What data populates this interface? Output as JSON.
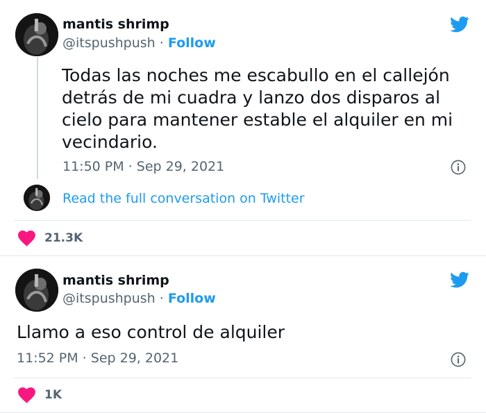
{
  "tweets": [
    {
      "author": "mantis shrimp",
      "handle": "@itspushpush",
      "separator": "·",
      "follow": "Follow",
      "text": "Todas las noches me escabullo en el callejón detrás de mi cuadra y lanzo dos disparos al cielo para mantener estable el alquiler en mi vecindario.",
      "time": "11:50 PM · Sep 29, 2021",
      "read_link": "Read the full conversation on Twitter",
      "likes": "21.3K"
    },
    {
      "author": "mantis shrimp",
      "handle": "@itspushpush",
      "separator": "·",
      "follow": "Follow",
      "text": "Llamo a eso control de alquiler",
      "time": "11:52 PM · Sep 29, 2021",
      "likes": "1K"
    }
  ],
  "colors": {
    "brand_blue": "#1d9bf0",
    "heart": "#f91880",
    "muted": "#536471",
    "text": "#0f1419"
  },
  "icons": [
    "twitter-bird-icon",
    "info-icon",
    "heart-icon",
    "avatar"
  ]
}
